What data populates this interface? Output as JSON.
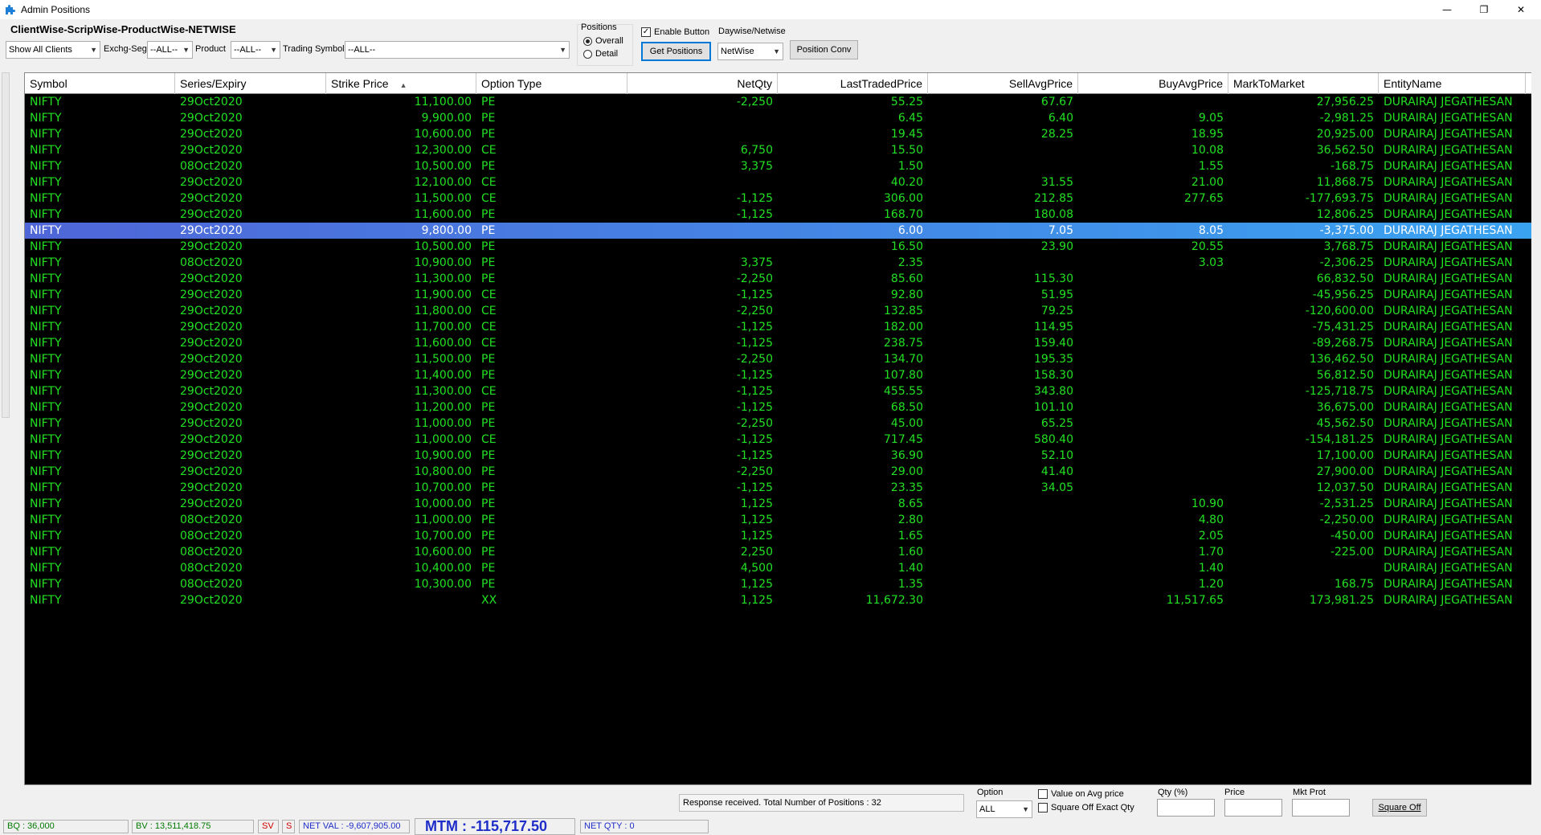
{
  "window": {
    "title": "Admin Positions",
    "controls": [
      "—",
      "❐",
      "✕"
    ]
  },
  "toolbar": {
    "view_title": "ClientWise-ScripWise-ProductWise-NETWISE",
    "client_combo": "Show All Clients",
    "exch_seg_label": "Exchg-Seg",
    "exch_seg_value": "--ALL--",
    "product_label": "Product",
    "product_value": "--ALL--",
    "trading_symbol_label": "Trading Symbol",
    "trading_symbol_value": "--ALL--",
    "positions_label": "Positions",
    "radio_overall": "Overall",
    "radio_detail": "Detail",
    "enable_button_label": "Enable Button",
    "get_positions_label": "Get Positions",
    "daywise_label": "Daywise/Netwise",
    "netwise_value": "NetWise",
    "position_conv_label": "Position Conv"
  },
  "grid": {
    "columns": [
      "Symbol",
      "Series/Expiry",
      "Strike Price",
      "Option Type",
      "NetQty",
      "LastTradedPrice",
      "SellAvgPrice",
      "BuyAvgPrice",
      "MarkToMarket",
      "EntityName"
    ],
    "selected_index": 8,
    "rows": [
      [
        "NIFTY",
        "29Oct2020",
        "11,100.00",
        "PE",
        "-2,250",
        "55.25",
        "67.67",
        "",
        "27,956.25",
        "DURAIRAJ  JEGATHESAN"
      ],
      [
        "NIFTY",
        "29Oct2020",
        "9,900.00",
        "PE",
        "",
        "6.45",
        "6.40",
        "9.05",
        "-2,981.25",
        "DURAIRAJ  JEGATHESAN"
      ],
      [
        "NIFTY",
        "29Oct2020",
        "10,600.00",
        "PE",
        "",
        "19.45",
        "28.25",
        "18.95",
        "20,925.00",
        "DURAIRAJ  JEGATHESAN"
      ],
      [
        "NIFTY",
        "29Oct2020",
        "12,300.00",
        "CE",
        "6,750",
        "15.50",
        "",
        "10.08",
        "36,562.50",
        "DURAIRAJ  JEGATHESAN"
      ],
      [
        "NIFTY",
        "08Oct2020",
        "10,500.00",
        "PE",
        "3,375",
        "1.50",
        "",
        "1.55",
        "-168.75",
        "DURAIRAJ  JEGATHESAN"
      ],
      [
        "NIFTY",
        "29Oct2020",
        "12,100.00",
        "CE",
        "",
        "40.20",
        "31.55",
        "21.00",
        "11,868.75",
        "DURAIRAJ  JEGATHESAN"
      ],
      [
        "NIFTY",
        "29Oct2020",
        "11,500.00",
        "CE",
        "-1,125",
        "306.00",
        "212.85",
        "277.65",
        "-177,693.75",
        "DURAIRAJ  JEGATHESAN"
      ],
      [
        "NIFTY",
        "29Oct2020",
        "11,600.00",
        "PE",
        "-1,125",
        "168.70",
        "180.08",
        "",
        "12,806.25",
        "DURAIRAJ  JEGATHESAN"
      ],
      [
        "NIFTY",
        "29Oct2020",
        "9,800.00",
        "PE",
        "",
        "6.00",
        "7.05",
        "8.05",
        "-3,375.00",
        "DURAIRAJ  JEGATHESAN"
      ],
      [
        "NIFTY",
        "29Oct2020",
        "10,500.00",
        "PE",
        "",
        "16.50",
        "23.90",
        "20.55",
        "3,768.75",
        "DURAIRAJ  JEGATHESAN"
      ],
      [
        "NIFTY",
        "08Oct2020",
        "10,900.00",
        "PE",
        "3,375",
        "2.35",
        "",
        "3.03",
        "-2,306.25",
        "DURAIRAJ  JEGATHESAN"
      ],
      [
        "NIFTY",
        "29Oct2020",
        "11,300.00",
        "PE",
        "-2,250",
        "85.60",
        "115.30",
        "",
        "66,832.50",
        "DURAIRAJ  JEGATHESAN"
      ],
      [
        "NIFTY",
        "29Oct2020",
        "11,900.00",
        "CE",
        "-1,125",
        "92.80",
        "51.95",
        "",
        "-45,956.25",
        "DURAIRAJ  JEGATHESAN"
      ],
      [
        "NIFTY",
        "29Oct2020",
        "11,800.00",
        "CE",
        "-2,250",
        "132.85",
        "79.25",
        "",
        "-120,600.00",
        "DURAIRAJ  JEGATHESAN"
      ],
      [
        "NIFTY",
        "29Oct2020",
        "11,700.00",
        "CE",
        "-1,125",
        "182.00",
        "114.95",
        "",
        "-75,431.25",
        "DURAIRAJ  JEGATHESAN"
      ],
      [
        "NIFTY",
        "29Oct2020",
        "11,600.00",
        "CE",
        "-1,125",
        "238.75",
        "159.40",
        "",
        "-89,268.75",
        "DURAIRAJ  JEGATHESAN"
      ],
      [
        "NIFTY",
        "29Oct2020",
        "11,500.00",
        "PE",
        "-2,250",
        "134.70",
        "195.35",
        "",
        "136,462.50",
        "DURAIRAJ  JEGATHESAN"
      ],
      [
        "NIFTY",
        "29Oct2020",
        "11,400.00",
        "PE",
        "-1,125",
        "107.80",
        "158.30",
        "",
        "56,812.50",
        "DURAIRAJ  JEGATHESAN"
      ],
      [
        "NIFTY",
        "29Oct2020",
        "11,300.00",
        "CE",
        "-1,125",
        "455.55",
        "343.80",
        "",
        "-125,718.75",
        "DURAIRAJ  JEGATHESAN"
      ],
      [
        "NIFTY",
        "29Oct2020",
        "11,200.00",
        "PE",
        "-1,125",
        "68.50",
        "101.10",
        "",
        "36,675.00",
        "DURAIRAJ  JEGATHESAN"
      ],
      [
        "NIFTY",
        "29Oct2020",
        "11,000.00",
        "PE",
        "-2,250",
        "45.00",
        "65.25",
        "",
        "45,562.50",
        "DURAIRAJ  JEGATHESAN"
      ],
      [
        "NIFTY",
        "29Oct2020",
        "11,000.00",
        "CE",
        "-1,125",
        "717.45",
        "580.40",
        "",
        "-154,181.25",
        "DURAIRAJ  JEGATHESAN"
      ],
      [
        "NIFTY",
        "29Oct2020",
        "10,900.00",
        "PE",
        "-1,125",
        "36.90",
        "52.10",
        "",
        "17,100.00",
        "DURAIRAJ  JEGATHESAN"
      ],
      [
        "NIFTY",
        "29Oct2020",
        "10,800.00",
        "PE",
        "-2,250",
        "29.00",
        "41.40",
        "",
        "27,900.00",
        "DURAIRAJ  JEGATHESAN"
      ],
      [
        "NIFTY",
        "29Oct2020",
        "10,700.00",
        "PE",
        "-1,125",
        "23.35",
        "34.05",
        "",
        "12,037.50",
        "DURAIRAJ  JEGATHESAN"
      ],
      [
        "NIFTY",
        "29Oct2020",
        "10,000.00",
        "PE",
        "1,125",
        "8.65",
        "",
        "10.90",
        "-2,531.25",
        "DURAIRAJ  JEGATHESAN"
      ],
      [
        "NIFTY",
        "08Oct2020",
        "11,000.00",
        "PE",
        "1,125",
        "2.80",
        "",
        "4.80",
        "-2,250.00",
        "DURAIRAJ  JEGATHESAN"
      ],
      [
        "NIFTY",
        "08Oct2020",
        "10,700.00",
        "PE",
        "1,125",
        "1.65",
        "",
        "2.05",
        "-450.00",
        "DURAIRAJ  JEGATHESAN"
      ],
      [
        "NIFTY",
        "08Oct2020",
        "10,600.00",
        "PE",
        "2,250",
        "1.60",
        "",
        "1.70",
        "-225.00",
        "DURAIRAJ  JEGATHESAN"
      ],
      [
        "NIFTY",
        "08Oct2020",
        "10,400.00",
        "PE",
        "4,500",
        "1.40",
        "",
        "1.40",
        "",
        "DURAIRAJ  JEGATHESAN"
      ],
      [
        "NIFTY",
        "08Oct2020",
        "10,300.00",
        "PE",
        "1,125",
        "1.35",
        "",
        "1.20",
        "168.75",
        "DURAIRAJ  JEGATHESAN"
      ],
      [
        "NIFTY",
        "29Oct2020",
        "",
        "XX",
        "1,125",
        "11,672.30",
        "",
        "11,517.65",
        "173,981.25",
        "DURAIRAJ  JEGATHESAN"
      ]
    ]
  },
  "bottom": {
    "status_message": "Response received. Total Number of Positions : 32",
    "option_label": "Option",
    "option_value": "ALL",
    "value_on_avg_label": "Value on Avg  price",
    "square_off_exact_label": "Square Off Exact Qty",
    "qty_label": "Qty (%)",
    "price_label": "Price",
    "mkt_prot_label": "Mkt Prot",
    "square_off_button": "Square Off"
  },
  "statusbar": {
    "bq": "BQ : 36,000",
    "bv": "BV : 13,511,418.75",
    "sv": "SV",
    "s": "S",
    "net_val": "NET VAL : -9,607,905.00",
    "mtm": "MTM : -115,717.50",
    "net_qty": "NET QTY : 0"
  },
  "colors": {
    "grid_bg": "#000000",
    "grid_text": "#22e022",
    "selection_start": "#4f66d8",
    "selection_end": "#3aa3f0"
  }
}
